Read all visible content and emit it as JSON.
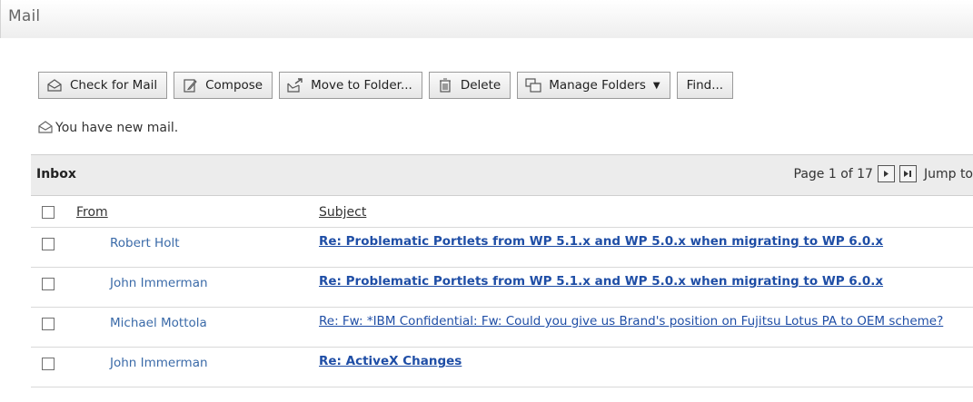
{
  "window": {
    "title": "Mail"
  },
  "toolbar": {
    "check_mail": "Check for Mail",
    "compose": "Compose",
    "move": "Move to Folder...",
    "delete": "Delete",
    "manage": "Manage Folders",
    "find": "Find..."
  },
  "notice": {
    "text": "You have new mail."
  },
  "inbox": {
    "label": "Inbox",
    "pager_text": "Page 1 of 17",
    "jump_label": "Jump to"
  },
  "columns": {
    "from": "From",
    "subject": "Subject"
  },
  "messages": [
    {
      "from": "Robert Holt",
      "subject": "Re: Problematic Portlets from WP 5.1.x and WP 5.0.x when migrating to WP 6.0.x",
      "unread": true
    },
    {
      "from": "John Immerman",
      "subject": "Re: Problematic Portlets from WP 5.1.x and WP 5.0.x when migrating to WP 6.0.x",
      "unread": true
    },
    {
      "from": "Michael Mottola",
      "subject": "Re: Fw: *IBM Confidential: Fw: Could you give us Brand's position on Fujitsu Lotus PA to OEM scheme?",
      "unread": false
    },
    {
      "from": "John Immerman",
      "subject": "Re: ActiveX Changes",
      "unread": true
    }
  ],
  "icons": {
    "check_mail": "envelope-icon",
    "compose": "compose-icon",
    "move": "move-to-folder-icon",
    "delete": "trash-icon",
    "manage": "folders-icon",
    "notice": "envelope-icon",
    "next_page": "next-page-icon",
    "last_page": "last-page-icon"
  },
  "colors": {
    "link": "#1f4ea6",
    "sender": "#3a6aa8",
    "header_bg": "#ececec"
  }
}
